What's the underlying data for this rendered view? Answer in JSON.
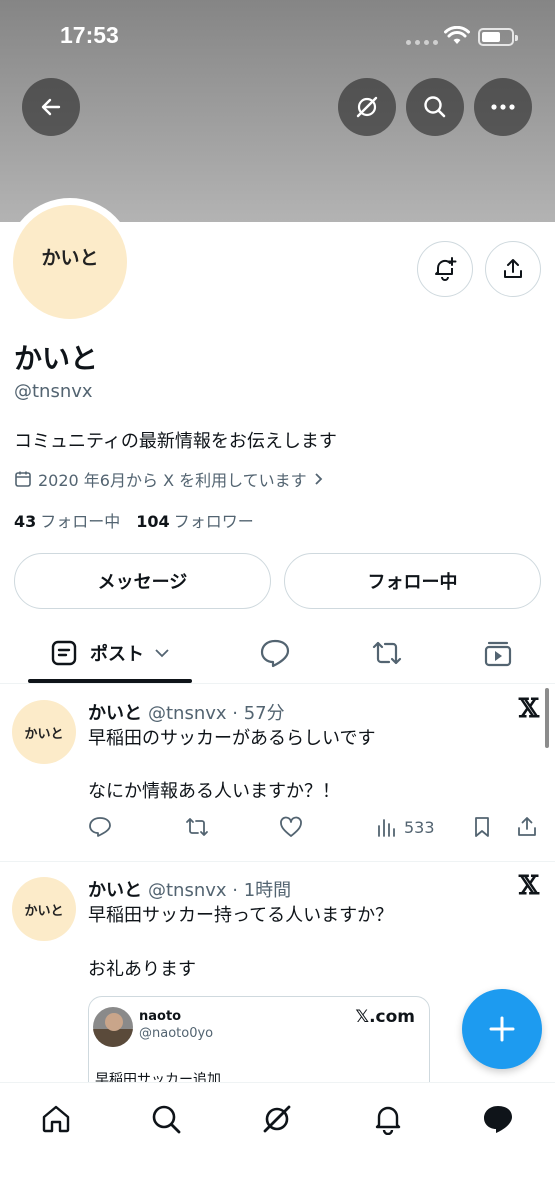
{
  "status_bar": {
    "time": "17:53"
  },
  "profile": {
    "avatar_text": "かいと",
    "name": "かいと",
    "handle": "@tnsnvx",
    "bio": "コミュニティの最新情報をお伝えします",
    "joined": "2020 年6月から X を利用しています",
    "following_count": "43",
    "following_label": "フォロー中",
    "followers_count": "104",
    "followers_label": "フォロワー",
    "message_button": "メッセージ",
    "following_button": "フォロー中"
  },
  "tabs": {
    "posts_label": "ポスト"
  },
  "posts": [
    {
      "avatar_text": "かいと",
      "name": "かいと",
      "meta": "@tnsnvx · 57分",
      "line1": "早稲田のサッカーがあるらしいです",
      "line2": "なにか情報ある人いますか？！",
      "views": "533"
    },
    {
      "avatar_text": "かいと",
      "name": "かいと",
      "meta": "@tnsnvx · 1時間",
      "line1": "早稲田サッカー持ってる人いますか？",
      "line2": "お礼あります",
      "card": {
        "name": "naoto",
        "handle": "@naoto0yo",
        "source": "𝕏.com",
        "text": "早稲田サッカー追加"
      }
    }
  ],
  "colors": {
    "accent": "#1d9bf0",
    "avatar_bg": "#fcebc9",
    "text": "#0f1419",
    "muted": "#536471"
  }
}
